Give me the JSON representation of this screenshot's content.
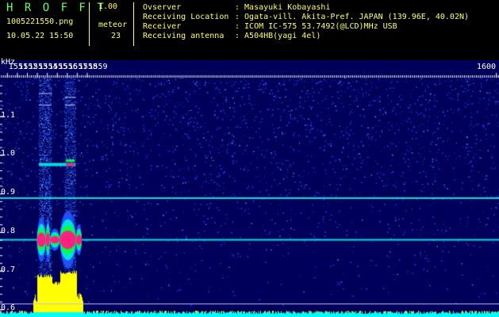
{
  "app": {
    "name": "H R O F F T",
    "version": "1.00",
    "file": "1005221550.png",
    "datetime": "10.05.22 15:50",
    "count_label": "meteor",
    "count_value": "23"
  },
  "info": {
    "observer_label": "Ovserver",
    "observer_value": ": Masayuki Kobayashi",
    "location_label": "Receiving Location",
    "location_value": ": Ogata-vill. Akita-Pref. JAPAN (139.96E, 40.02N)",
    "receiver_label": "Receiver",
    "receiver_value": ": ICOM IC-575 53.7492(@LCD)MHz USB",
    "antenna_label": "Receiving antenna",
    "antenna_value": ": A504HB(yagi 4el)"
  },
  "chart_data": {
    "type": "heatmap",
    "ylabel": "kHz",
    "ylim": [
      0.58,
      1.2
    ],
    "xlim": [
      1550.3,
      1600.3
    ],
    "y_ticks": [
      "1.1",
      "1.0",
      "0.9",
      "0.8",
      "0.7",
      "0.6"
    ],
    "y_tick_values": [
      1.1,
      1.0,
      0.9,
      0.8,
      0.7,
      0.6
    ],
    "x_ticks": [
      "1551",
      "1552",
      "1553",
      "1554",
      "1555",
      "1556",
      "1557",
      "1558",
      "1559",
      "1600"
    ],
    "x_tick_values": [
      1551,
      1552,
      1553,
      1554,
      1555,
      1556,
      1557,
      1558,
      1559,
      1600
    ],
    "carrier_freq": 0.89,
    "meteor_echo_freq": 0.78,
    "colors": {
      "background": "#00005a",
      "noise": "#2040ff",
      "signal_low": "#00e0e0",
      "signal_mid": "#00ff40",
      "signal_high": "#ff2080",
      "level": "#ffff00",
      "level_low": "#00ffff",
      "tick": "#ffffff"
    }
  }
}
